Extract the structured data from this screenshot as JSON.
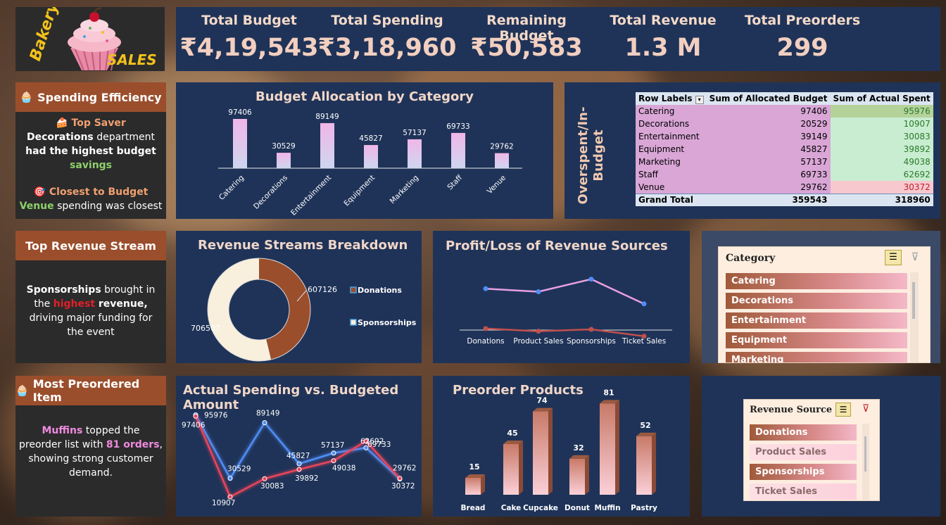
{
  "logo": {
    "word1": "Bakery",
    "word2": "SALES"
  },
  "kpis": [
    {
      "label": "Total Budget",
      "value": "₹4,19,543"
    },
    {
      "label": "Total Spending",
      "value": "₹3,18,960"
    },
    {
      "label": "Remaining Budget",
      "value": "₹50,583"
    },
    {
      "label": "Total Revenue",
      "value": "1.3 M"
    },
    {
      "label": "Total Preorders",
      "value": "299"
    }
  ],
  "spending_efficiency": {
    "title": "Spending Efficiency",
    "top_saver_label": "Top Saver",
    "top_saver_dept": "Decorations",
    "top_saver_text1": " department",
    "top_saver_text2": "had the highest budget",
    "top_saver_text3": "savings",
    "closest_label": "Closest to Budget",
    "closest_dept": "Venue",
    "closest_text": " spending was closest"
  },
  "top_revenue_stream": {
    "title": "Top Revenue Stream",
    "name": "Sponsorships",
    "text1": " brought in",
    "text2a": "the ",
    "text2b": "highest",
    "text2c": " revenue,",
    "text3": "driving major funding for",
    "text4": "the event"
  },
  "most_preordered": {
    "title": "Most Preordered Item",
    "name": "Muffins",
    "text1": " topped the",
    "text2a": "preorder list with ",
    "text2b": "81 orders",
    "text2c": ",",
    "text3": "showing strong customer",
    "text4": "demand."
  },
  "pivot": {
    "side_label": "Overspent/In-Budget",
    "headers": [
      "Row Labels",
      "Sum of Allocated Budget",
      "Sum of Actual Spent"
    ],
    "rows": [
      {
        "label": "Catering",
        "allocated": "97406",
        "spent": "95976",
        "over": false
      },
      {
        "label": "Decorations",
        "allocated": "20529",
        "spent": "10907",
        "over": false
      },
      {
        "label": "Entertainment",
        "allocated": "39149",
        "spent": "30083",
        "over": false
      },
      {
        "label": "Equipment",
        "allocated": "45827",
        "spent": "39892",
        "over": false
      },
      {
        "label": "Marketing",
        "allocated": "57137",
        "spent": "49038",
        "over": false
      },
      {
        "label": "Staff",
        "allocated": "69733",
        "spent": "62692",
        "over": false
      },
      {
        "label": "Venue",
        "allocated": "29762",
        "spent": "30372",
        "over": true
      }
    ],
    "total": {
      "label": "Grand Total",
      "allocated": "359543",
      "spent": "318960"
    }
  },
  "slicer_category": {
    "title": "Category",
    "items": [
      "Catering",
      "Decorations",
      "Entertainment",
      "Equipment",
      "Marketing"
    ]
  },
  "slicer_revenue": {
    "title": "Revenue Source",
    "items": [
      {
        "label": "Donations",
        "selected": true
      },
      {
        "label": "Product Sales",
        "selected": false
      },
      {
        "label": "Sponsorships",
        "selected": true
      },
      {
        "label": "Ticket Sales",
        "selected": false
      }
    ]
  },
  "chart_data": [
    {
      "id": "budget_alloc",
      "type": "bar",
      "title": "Budget Allocation by Category",
      "categories": [
        "Catering",
        "Decorations",
        "Entertainment",
        "Equipment",
        "Marketing",
        "Staff",
        "Venue"
      ],
      "values": [
        97406,
        30529,
        89149,
        45827,
        57137,
        69733,
        29762
      ]
    },
    {
      "id": "revenue_streams",
      "type": "pie",
      "title": "Revenue Streams Breakdown",
      "labels": [
        "Donations",
        "Sponsorships"
      ],
      "values": [
        607126,
        706507
      ],
      "colors": [
        "#9b4e2c",
        "#f8f0dc"
      ]
    },
    {
      "id": "profit_loss",
      "type": "line",
      "title": "Profit/Loss of Revenue Sources",
      "categories": [
        "Donations",
        "Product Sales",
        "Sponsorships",
        "Ticket Sales"
      ],
      "series": [
        {
          "values": [
            0.7,
            0.62,
            0.95,
            0.3
          ],
          "color": "#e6a0e0"
        },
        {
          "values": [
            -0.35,
            -0.42,
            -0.37,
            -0.55
          ],
          "color": "#c0504d"
        }
      ]
    },
    {
      "id": "actual_vs_budget",
      "type": "line",
      "title": "Actual Spending vs. Budgeted Amount",
      "series": [
        {
          "values": [
            97406,
            30529,
            89149,
            45827,
            57137,
            62692,
            29762
          ],
          "color": "#4f8ef7"
        },
        {
          "values": [
            95976,
            10907,
            30083,
            39892,
            49038,
            69733,
            30372
          ],
          "color": "#e8455a"
        }
      ]
    },
    {
      "id": "preorders",
      "type": "bar",
      "title": "Preorder Products",
      "categories": [
        "Bread",
        "Cake",
        "Cupcake",
        "Donut",
        "Muffin",
        "Pastry"
      ],
      "values": [
        15,
        45,
        74,
        32,
        81,
        52
      ]
    }
  ]
}
